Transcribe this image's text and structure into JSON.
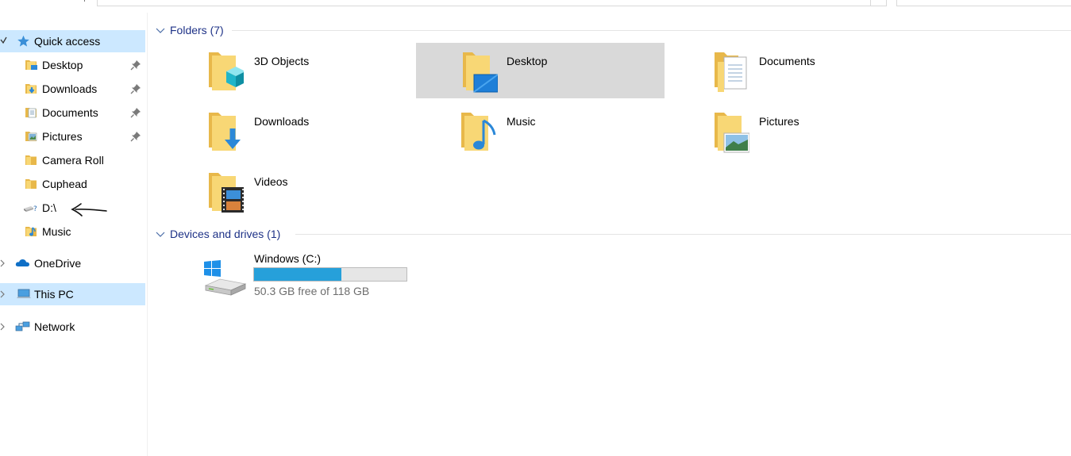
{
  "nav": {
    "quick_access": "Quick access",
    "pinned": [
      {
        "label": "Desktop",
        "icon": "desktop-folder-icon"
      },
      {
        "label": "Downloads",
        "icon": "downloads-folder-icon"
      },
      {
        "label": "Documents",
        "icon": "documents-folder-icon"
      },
      {
        "label": "Pictures",
        "icon": "pictures-folder-icon"
      }
    ],
    "recent": [
      {
        "label": "Camera Roll",
        "icon": "folder-icon"
      },
      {
        "label": "Cuphead",
        "icon": "folder-icon"
      },
      {
        "label": "D:\\",
        "icon": "drive-icon"
      },
      {
        "label": "Music",
        "icon": "music-folder-icon"
      }
    ],
    "onedrive": "OneDrive",
    "this_pc": "This PC",
    "network": "Network"
  },
  "main": {
    "folders_header": "Folders (7)",
    "folders": [
      {
        "label": "3D Objects",
        "icon": "3d-objects-folder-icon"
      },
      {
        "label": "Desktop",
        "icon": "desktop-folder-icon"
      },
      {
        "label": "Documents",
        "icon": "documents-folder-icon"
      },
      {
        "label": "Downloads",
        "icon": "downloads-folder-icon"
      },
      {
        "label": "Music",
        "icon": "music-folder-icon"
      },
      {
        "label": "Pictures",
        "icon": "pictures-folder-icon"
      },
      {
        "label": "Videos",
        "icon": "videos-folder-icon"
      }
    ],
    "devices_header": "Devices and drives (1)",
    "drive": {
      "name": "Windows (C:)",
      "free_text": "50.3 GB free of 118 GB",
      "used_fraction": 0.574
    }
  },
  "colors": {
    "selection": "#cce8ff",
    "tile_selected": "#d9d9d9",
    "group_header": "#1e3287",
    "usage_bar": "#26a0da",
    "folder": "#f8d775"
  }
}
